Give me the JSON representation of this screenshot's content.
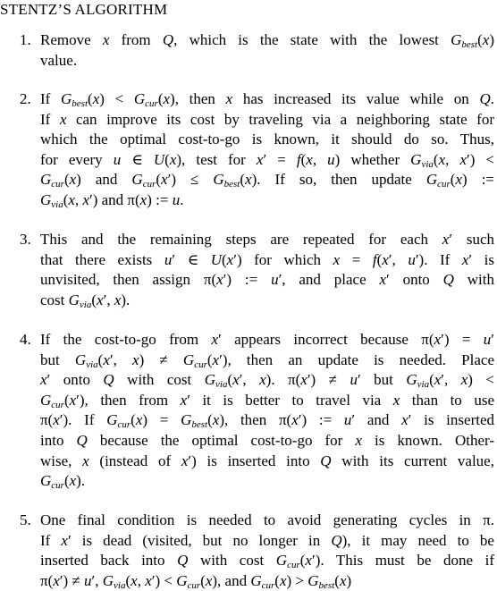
{
  "title": "STENTZ’S ALGORITHM",
  "items": [
    {
      "number": "1.",
      "lines": [
        [
          [
            "t",
            "Remove "
          ],
          [
            "m",
            "x"
          ],
          [
            "t",
            " from "
          ],
          [
            "m",
            "Q"
          ],
          [
            "t",
            ", which is the state with the lowest "
          ],
          [
            "m",
            "G"
          ],
          [
            "s",
            "best"
          ],
          [
            "t",
            "("
          ],
          [
            "m",
            "x"
          ],
          [
            "t",
            ")"
          ]
        ],
        [
          [
            "t",
            "value."
          ]
        ]
      ]
    },
    {
      "number": "2.",
      "lines": [
        [
          [
            "t",
            "If "
          ],
          [
            "m",
            "G"
          ],
          [
            "s",
            "best"
          ],
          [
            "t",
            "("
          ],
          [
            "m",
            "x"
          ],
          [
            "t",
            ") < "
          ],
          [
            "m",
            "G"
          ],
          [
            "s",
            "cur"
          ],
          [
            "t",
            "("
          ],
          [
            "m",
            "x"
          ],
          [
            "t",
            "), then "
          ],
          [
            "m",
            "x"
          ],
          [
            "t",
            " has increased its value while on "
          ],
          [
            "m",
            "Q"
          ],
          [
            "t",
            "."
          ]
        ],
        [
          [
            "t",
            "If "
          ],
          [
            "m",
            "x"
          ],
          [
            "t",
            " can improve its cost by traveling via a neighboring state for"
          ]
        ],
        [
          [
            "t",
            "which the optimal cost-to-go is known, it should do so. Thus,"
          ]
        ],
        [
          [
            "t",
            "for every "
          ],
          [
            "m",
            "u"
          ],
          [
            "t",
            " ∈ "
          ],
          [
            "m",
            "U"
          ],
          [
            "t",
            "("
          ],
          [
            "m",
            "x"
          ],
          [
            "t",
            "), test for "
          ],
          [
            "m",
            "x"
          ],
          [
            "t",
            "′ = "
          ],
          [
            "m",
            "f"
          ],
          [
            "t",
            "("
          ],
          [
            "m",
            "x"
          ],
          [
            "t",
            ", "
          ],
          [
            "m",
            "u"
          ],
          [
            "t",
            ") whether "
          ],
          [
            "m",
            "G"
          ],
          [
            "s",
            "via"
          ],
          [
            "t",
            "("
          ],
          [
            "m",
            "x"
          ],
          [
            "t",
            ", "
          ],
          [
            "m",
            "x"
          ],
          [
            "t",
            "′) <"
          ]
        ],
        [
          [
            "m",
            "G"
          ],
          [
            "s",
            "cur"
          ],
          [
            "t",
            "("
          ],
          [
            "m",
            "x"
          ],
          [
            "t",
            ") and "
          ],
          [
            "m",
            "G"
          ],
          [
            "s",
            "cur"
          ],
          [
            "t",
            "("
          ],
          [
            "m",
            "x"
          ],
          [
            "t",
            "′) ≤ "
          ],
          [
            "m",
            "G"
          ],
          [
            "s",
            "best"
          ],
          [
            "t",
            "("
          ],
          [
            "m",
            "x"
          ],
          [
            "t",
            "). If so, then update "
          ],
          [
            "m",
            "G"
          ],
          [
            "s",
            "cur"
          ],
          [
            "t",
            "("
          ],
          [
            "m",
            "x"
          ],
          [
            "t",
            ") :="
          ]
        ],
        [
          [
            "m",
            "G"
          ],
          [
            "s",
            "via"
          ],
          [
            "t",
            "("
          ],
          [
            "m",
            "x"
          ],
          [
            "t",
            ", "
          ],
          [
            "m",
            "x"
          ],
          [
            "t",
            "′) and π("
          ],
          [
            "m",
            "x"
          ],
          [
            "t",
            ") := "
          ],
          [
            "m",
            "u"
          ],
          [
            "t",
            "."
          ]
        ]
      ]
    },
    {
      "number": "3.",
      "lines": [
        [
          [
            "t",
            "This and the remaining steps are repeated for each "
          ],
          [
            "m",
            "x"
          ],
          [
            "t",
            "′ such"
          ]
        ],
        [
          [
            "t",
            "that there exists "
          ],
          [
            "m",
            "u"
          ],
          [
            "t",
            "′ ∈ "
          ],
          [
            "m",
            "U"
          ],
          [
            "t",
            "("
          ],
          [
            "m",
            "x"
          ],
          [
            "t",
            "′) for which "
          ],
          [
            "m",
            "x"
          ],
          [
            "t",
            " = "
          ],
          [
            "m",
            "f"
          ],
          [
            "t",
            "("
          ],
          [
            "m",
            "x"
          ],
          [
            "t",
            "′, "
          ],
          [
            "m",
            "u"
          ],
          [
            "t",
            "′). If "
          ],
          [
            "m",
            "x"
          ],
          [
            "t",
            "′ is"
          ]
        ],
        [
          [
            "t",
            "unvisited, then assign π("
          ],
          [
            "m",
            "x"
          ],
          [
            "t",
            "′) := "
          ],
          [
            "m",
            "u"
          ],
          [
            "t",
            "′, and place "
          ],
          [
            "m",
            "x"
          ],
          [
            "t",
            "′ onto "
          ],
          [
            "m",
            "Q"
          ],
          [
            "t",
            " with"
          ]
        ],
        [
          [
            "t",
            "cost "
          ],
          [
            "m",
            "G"
          ],
          [
            "s",
            "via"
          ],
          [
            "t",
            "("
          ],
          [
            "m",
            "x"
          ],
          [
            "t",
            "′, "
          ],
          [
            "m",
            "x"
          ],
          [
            "t",
            ")."
          ]
        ]
      ]
    },
    {
      "number": "4.",
      "lines": [
        [
          [
            "t",
            "If the cost-to-go from "
          ],
          [
            "m",
            "x"
          ],
          [
            "t",
            "′ appears incorrect because π("
          ],
          [
            "m",
            "x"
          ],
          [
            "t",
            "′) = "
          ],
          [
            "m",
            "u"
          ],
          [
            "t",
            "′"
          ]
        ],
        [
          [
            "t",
            "but "
          ],
          [
            "m",
            "G"
          ],
          [
            "s",
            "via"
          ],
          [
            "t",
            "("
          ],
          [
            "m",
            "x"
          ],
          [
            "t",
            "′, "
          ],
          [
            "m",
            "x"
          ],
          [
            "t",
            ") ≠ "
          ],
          [
            "m",
            "G"
          ],
          [
            "s",
            "cur"
          ],
          [
            "t",
            "("
          ],
          [
            "m",
            "x"
          ],
          [
            "t",
            "′), then an update is needed. Place"
          ]
        ],
        [
          [
            "m",
            "x"
          ],
          [
            "t",
            "′ onto "
          ],
          [
            "m",
            "Q"
          ],
          [
            "t",
            " with cost "
          ],
          [
            "m",
            "G"
          ],
          [
            "s",
            "via"
          ],
          [
            "t",
            "("
          ],
          [
            "m",
            "x"
          ],
          [
            "t",
            "′, "
          ],
          [
            "m",
            "x"
          ],
          [
            "t",
            "). π("
          ],
          [
            "m",
            "x"
          ],
          [
            "t",
            "′) ≠ "
          ],
          [
            "m",
            "u"
          ],
          [
            "t",
            "′ but "
          ],
          [
            "m",
            "G"
          ],
          [
            "s",
            "via"
          ],
          [
            "t",
            "("
          ],
          [
            "m",
            "x"
          ],
          [
            "t",
            "′, "
          ],
          [
            "m",
            "x"
          ],
          [
            "t",
            ") <"
          ]
        ],
        [
          [
            "m",
            "G"
          ],
          [
            "s",
            "cur"
          ],
          [
            "t",
            "("
          ],
          [
            "m",
            "x"
          ],
          [
            "t",
            "′), then from "
          ],
          [
            "m",
            "x"
          ],
          [
            "t",
            "′ it is better to travel via "
          ],
          [
            "m",
            "x"
          ],
          [
            "t",
            " than to use"
          ]
        ],
        [
          [
            "t",
            "π("
          ],
          [
            "m",
            "x"
          ],
          [
            "t",
            "′). If "
          ],
          [
            "m",
            "G"
          ],
          [
            "s",
            "cur"
          ],
          [
            "t",
            "("
          ],
          [
            "m",
            "x"
          ],
          [
            "t",
            ") = "
          ],
          [
            "m",
            "G"
          ],
          [
            "s",
            "best"
          ],
          [
            "t",
            "("
          ],
          [
            "m",
            "x"
          ],
          [
            "t",
            "), then π("
          ],
          [
            "m",
            "x"
          ],
          [
            "t",
            "′) := "
          ],
          [
            "m",
            "u"
          ],
          [
            "t",
            "′ and "
          ],
          [
            "m",
            "x"
          ],
          [
            "t",
            "′ is inserted"
          ]
        ],
        [
          [
            "t",
            "into "
          ],
          [
            "m",
            "Q"
          ],
          [
            "t",
            " because the optimal cost-to-go for "
          ],
          [
            "m",
            "x"
          ],
          [
            "t",
            " is known. Other-"
          ]
        ],
        [
          [
            "t",
            "wise, "
          ],
          [
            "m",
            "x"
          ],
          [
            "t",
            " (instead of "
          ],
          [
            "m",
            "x"
          ],
          [
            "t",
            "′) is inserted into "
          ],
          [
            "m",
            "Q"
          ],
          [
            "t",
            " with its current value,"
          ]
        ],
        [
          [
            "m",
            "G"
          ],
          [
            "s",
            "cur"
          ],
          [
            "t",
            "("
          ],
          [
            "m",
            "x"
          ],
          [
            "t",
            ")."
          ]
        ]
      ]
    },
    {
      "number": "5.",
      "lines": [
        [
          [
            "t",
            "One final condition is needed to avoid generating cycles in π."
          ]
        ],
        [
          [
            "t",
            "If "
          ],
          [
            "m",
            "x"
          ],
          [
            "t",
            "′ is dead (visited, but no longer in "
          ],
          [
            "m",
            "Q"
          ],
          [
            "t",
            "), it may need to be"
          ]
        ],
        [
          [
            "t",
            "inserted back into "
          ],
          [
            "m",
            "Q"
          ],
          [
            "t",
            " with cost "
          ],
          [
            "m",
            "G"
          ],
          [
            "s",
            "cur"
          ],
          [
            "t",
            "("
          ],
          [
            "m",
            "x"
          ],
          [
            "t",
            "′). This must be done if"
          ]
        ],
        [
          [
            "t",
            "π("
          ],
          [
            "m",
            "x"
          ],
          [
            "t",
            "′) ≠ "
          ],
          [
            "m",
            "u"
          ],
          [
            "t",
            "′, "
          ],
          [
            "m",
            "G"
          ],
          [
            "s",
            "via"
          ],
          [
            "t",
            "("
          ],
          [
            "m",
            "x"
          ],
          [
            "t",
            ", "
          ],
          [
            "m",
            "x"
          ],
          [
            "t",
            "′) < "
          ],
          [
            "m",
            "G"
          ],
          [
            "s",
            "cur"
          ],
          [
            "t",
            "("
          ],
          [
            "m",
            "x"
          ],
          [
            "t",
            "), and "
          ],
          [
            "m",
            "G"
          ],
          [
            "s",
            "cur"
          ],
          [
            "t",
            "("
          ],
          [
            "m",
            "x"
          ],
          [
            "t",
            ") > "
          ],
          [
            "m",
            "G"
          ],
          [
            "s",
            "best"
          ],
          [
            "t",
            "("
          ],
          [
            "m",
            "x"
          ],
          [
            "t",
            ")"
          ]
        ]
      ]
    }
  ]
}
